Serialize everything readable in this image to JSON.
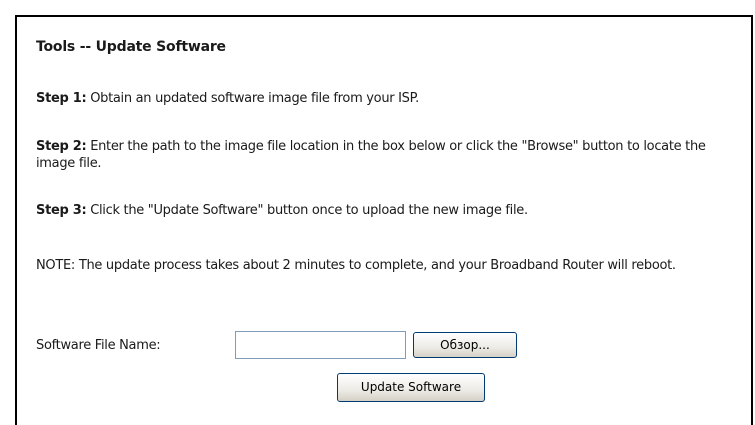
{
  "page": {
    "title": "Tools -- Update Software"
  },
  "steps": [
    {
      "label": "Step 1:",
      "text": " Obtain an updated software image file from your ISP."
    },
    {
      "label": "Step 2:",
      "text": " Enter the path to the image file location in the box below or click the \"Browse\" button to locate the image file."
    },
    {
      "label": "Step 3:",
      "text": " Click the \"Update Software\" button once to upload the new image file."
    }
  ],
  "note": "NOTE: The update process takes about 2 minutes to complete, and your Broadband Router will reboot.",
  "form": {
    "file_label": "Software File Name:",
    "file_value": "",
    "browse_label": "Обзор...",
    "update_label": "Update Software"
  }
}
